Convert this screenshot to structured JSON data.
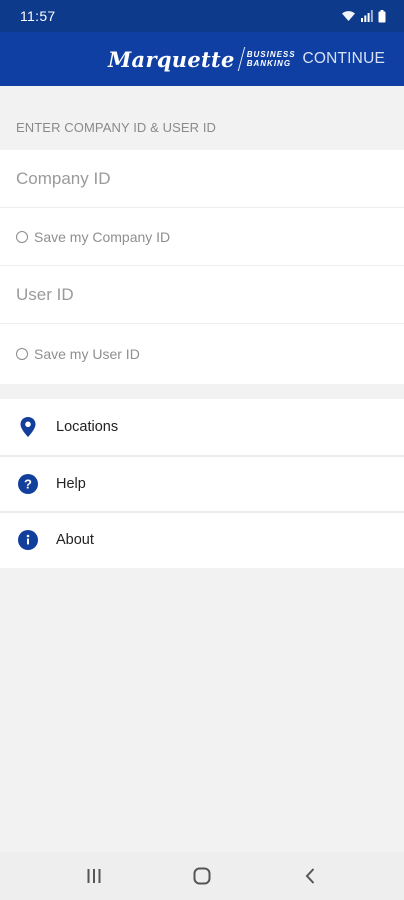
{
  "status_bar": {
    "time": "11:57",
    "icons": [
      "wifi-icon",
      "signal-icon",
      "battery-icon"
    ]
  },
  "header": {
    "logo_script": "Marquette",
    "logo_line1": "BUSINESS",
    "logo_line2": "BANKING",
    "continue_label": "CONTINUE",
    "background": "#0f3fa3"
  },
  "login": {
    "section_title": "ENTER COMPANY ID & USER ID",
    "company_id_placeholder": "Company ID",
    "company_id_value": "",
    "save_company_label": "Save my Company ID",
    "user_id_placeholder": "User ID",
    "user_id_value": "",
    "save_user_label": "Save my User ID"
  },
  "menu": {
    "items": [
      {
        "label": "Locations",
        "icon": "location-pin-icon"
      },
      {
        "label": "Help",
        "icon": "help-icon"
      },
      {
        "label": "About",
        "icon": "info-icon"
      }
    ]
  },
  "nav_bar": {
    "buttons": [
      "recent-apps-icon",
      "home-icon",
      "back-icon"
    ]
  },
  "colors": {
    "brand_blue": "#0f3fa3",
    "status_bar_blue": "#0e3a8c",
    "icon_blue": "#123e9c"
  }
}
